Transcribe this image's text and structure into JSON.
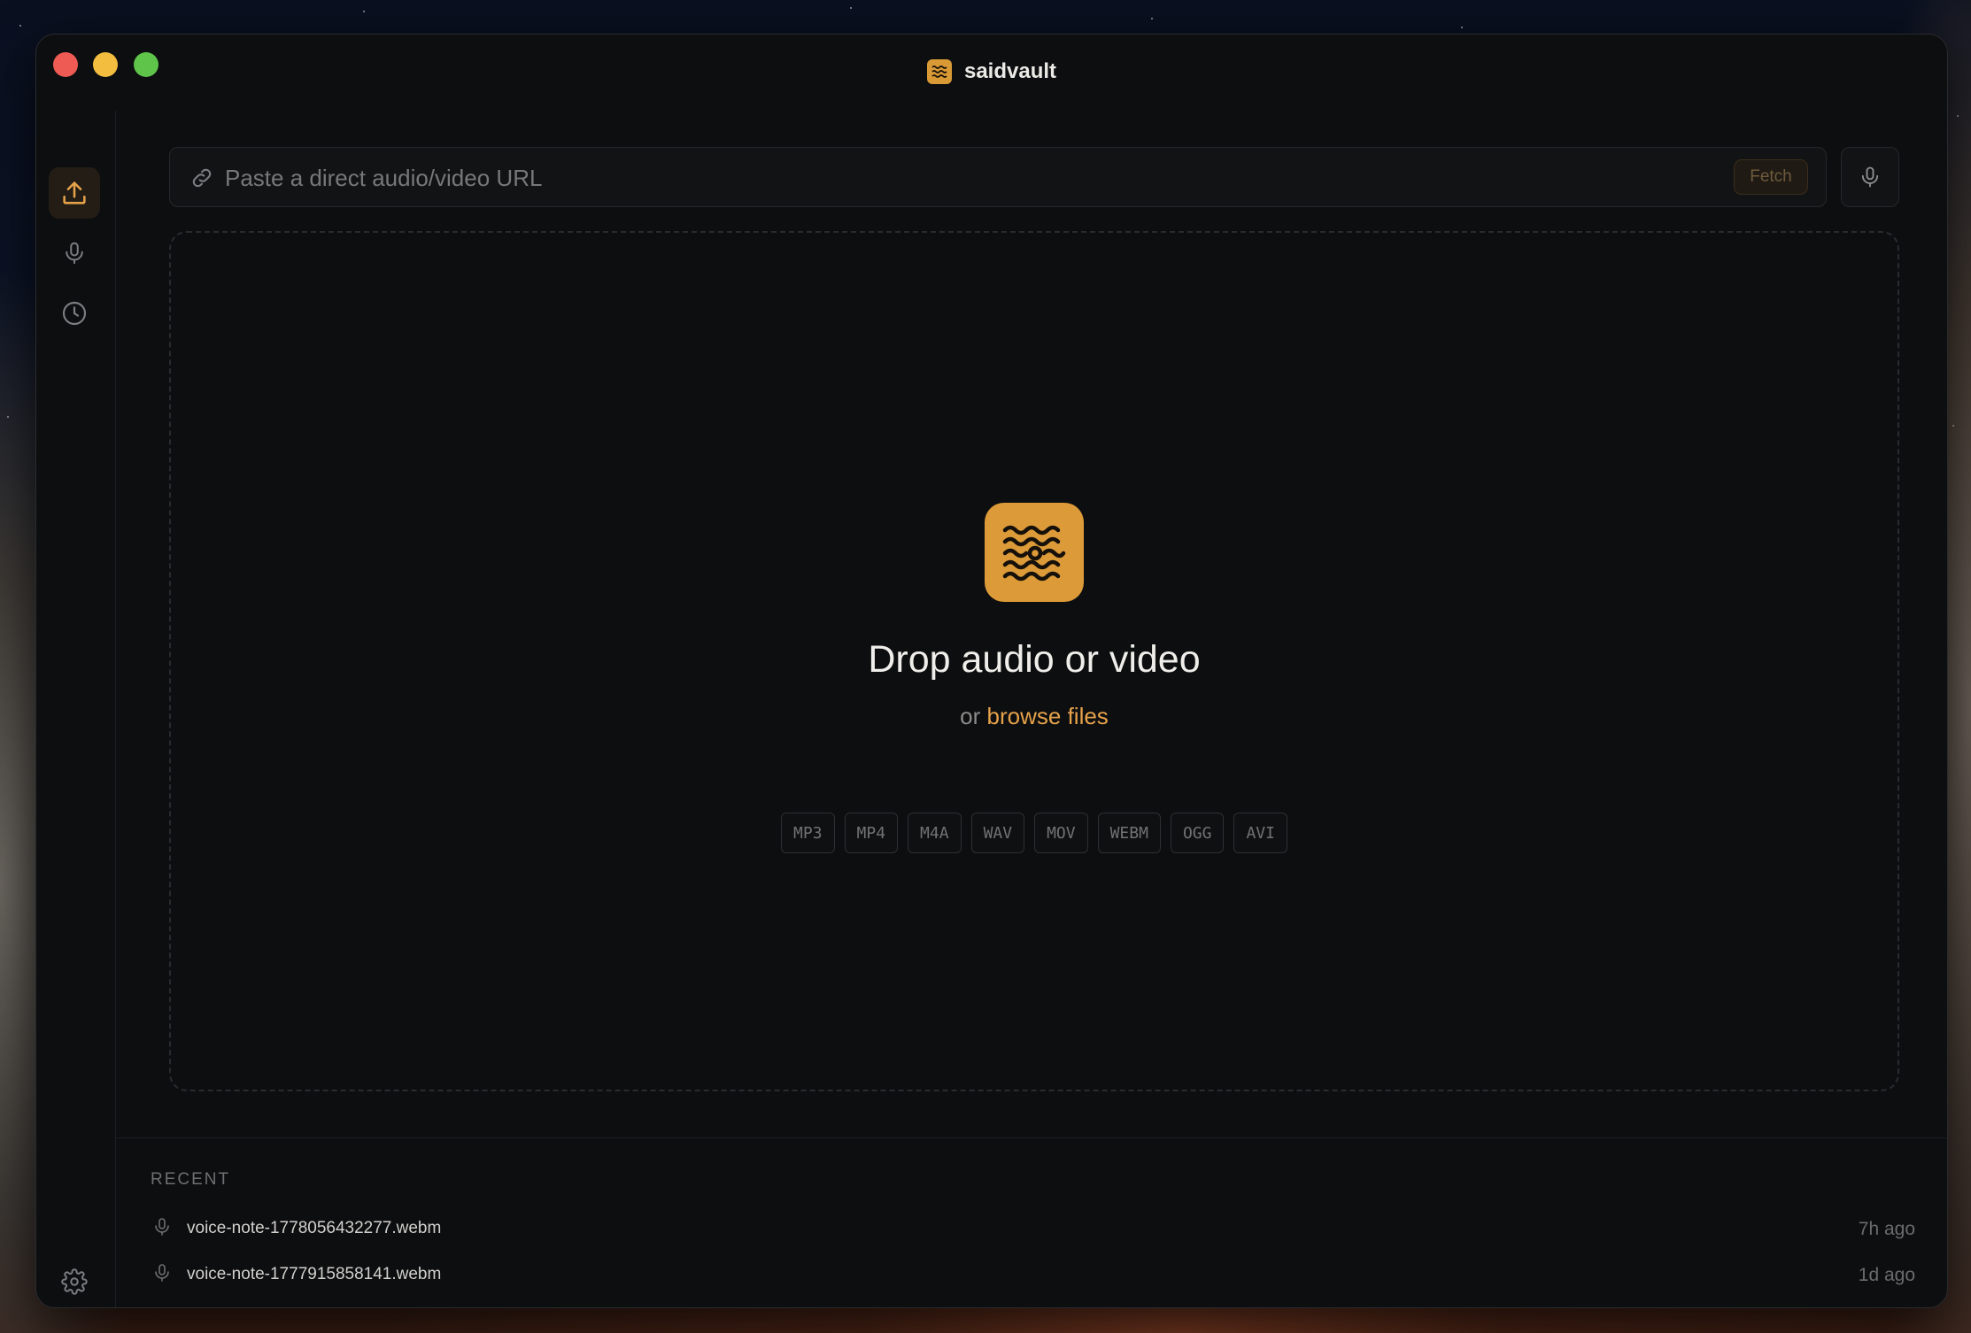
{
  "window": {
    "title": "saidvault",
    "logo_icon": "saidvault-logo-icon"
  },
  "sidebar": {
    "items": [
      {
        "name": "upload",
        "icon": "upload-icon",
        "active": true
      },
      {
        "name": "record",
        "icon": "microphone-icon",
        "active": false
      },
      {
        "name": "history",
        "icon": "clock-icon",
        "active": false
      }
    ],
    "footer_icon": "gear-icon"
  },
  "url_bar": {
    "placeholder": "Paste a direct audio/video URL",
    "value": "",
    "fetch_label": "Fetch",
    "link_icon": "link-icon",
    "mic_icon": "microphone-icon"
  },
  "dropzone": {
    "title": "Drop audio or video",
    "sub_prefix": "or",
    "browse_label": "browse files",
    "formats": [
      "MP3",
      "MP4",
      "M4A",
      "WAV",
      "MOV",
      "WEBM",
      "OGG",
      "AVI"
    ]
  },
  "recent": {
    "heading": "RECENT",
    "items": [
      {
        "name": "voice-note-1778056432277.webm",
        "time": "7h ago",
        "icon": "microphone-icon"
      },
      {
        "name": "voice-note-1777915858141.webm",
        "time": "1d ago",
        "icon": "microphone-icon"
      }
    ]
  },
  "colors": {
    "accent": "#dc9b38",
    "link": "#e6a24a",
    "background": "#0d0e10"
  }
}
